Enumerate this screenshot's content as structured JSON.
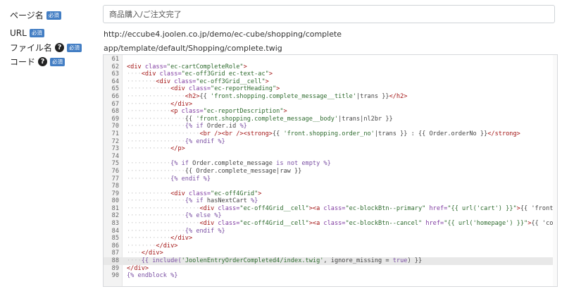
{
  "form": {
    "page_name": {
      "label": "ページ名",
      "badge": "必須",
      "value": "商品購入/ご注文完了"
    },
    "url": {
      "label": "URL",
      "badge": "必須",
      "value": "http://eccube4.joolen.co.jp/demo/ec-cube/shopping/complete"
    },
    "file_name": {
      "label": "ファイル名",
      "badge": "必須",
      "value": "app/template/default/Shopping/complete.twig"
    },
    "code": {
      "label": "コード",
      "badge": "必須"
    }
  },
  "editor": {
    "active_line": 88,
    "lines": [
      {
        "n": "61",
        "indent": 0,
        "tokens": []
      },
      {
        "n": "62",
        "indent": 0,
        "tokens": [
          [
            "tg",
            "<div "
          ],
          [
            "at",
            "class="
          ],
          [
            "st",
            "\"ec-cartCompleteRole\""
          ],
          [
            "tg",
            ">"
          ]
        ]
      },
      {
        "n": "63",
        "indent": 1,
        "tokens": [
          [
            "tg",
            "<div "
          ],
          [
            "at",
            "class="
          ],
          [
            "st",
            "\"ec-off3Grid ec-text-ac\""
          ],
          [
            "tg",
            ">"
          ]
        ]
      },
      {
        "n": "64",
        "indent": 2,
        "tokens": [
          [
            "tg",
            "<div "
          ],
          [
            "at",
            "class="
          ],
          [
            "st",
            "\"ec-off3Grid__cell\""
          ],
          [
            "tg",
            ">"
          ]
        ]
      },
      {
        "n": "65",
        "indent": 3,
        "tokens": [
          [
            "tg",
            "<div "
          ],
          [
            "at",
            "class="
          ],
          [
            "st",
            "\"ec-reportHeading\""
          ],
          [
            "tg",
            ">"
          ]
        ]
      },
      {
        "n": "66",
        "indent": 4,
        "tokens": [
          [
            "tg",
            "<h2>"
          ],
          [
            "tx",
            "{{ "
          ],
          [
            "st",
            "'front.shopping.complete_message__title'"
          ],
          [
            "tx",
            "|trans }}"
          ],
          [
            "tg",
            "</h2>"
          ]
        ]
      },
      {
        "n": "67",
        "indent": 3,
        "tokens": [
          [
            "tg",
            "</div>"
          ]
        ]
      },
      {
        "n": "68",
        "indent": 3,
        "tokens": [
          [
            "tg",
            "<p "
          ],
          [
            "at",
            "class="
          ],
          [
            "st",
            "\"ec-reportDescription\""
          ],
          [
            "tg",
            ">"
          ]
        ]
      },
      {
        "n": "69",
        "indent": 4,
        "tokens": [
          [
            "tx",
            "{{ "
          ],
          [
            "st",
            "'front.shopping.complete_message__body'"
          ],
          [
            "tx",
            "|trans|nl2br }}"
          ]
        ]
      },
      {
        "n": "70",
        "indent": 4,
        "tokens": [
          [
            "kw",
            "{% "
          ],
          [
            "kw",
            "if "
          ],
          [
            "tx",
            "Order.id "
          ],
          [
            "kw",
            "%}"
          ]
        ]
      },
      {
        "n": "71",
        "indent": 5,
        "tokens": [
          [
            "tg",
            "<br /><br /><strong>"
          ],
          [
            "tx",
            "{{ "
          ],
          [
            "st",
            "'front.shopping.order_no'"
          ],
          [
            "tx",
            "|trans }} : {{ Order.orderNo }}"
          ],
          [
            "tg",
            "</strong>"
          ]
        ]
      },
      {
        "n": "72",
        "indent": 4,
        "tokens": [
          [
            "kw",
            "{% "
          ],
          [
            "kw",
            "endif "
          ],
          [
            "kw",
            "%}"
          ]
        ]
      },
      {
        "n": "73",
        "indent": 3,
        "tokens": [
          [
            "tg",
            "</p>"
          ]
        ]
      },
      {
        "n": "74",
        "indent": 0,
        "tokens": []
      },
      {
        "n": "75",
        "indent": 3,
        "tokens": [
          [
            "kw",
            "{% "
          ],
          [
            "kw",
            "if "
          ],
          [
            "tx",
            "Order.complete_message "
          ],
          [
            "kw",
            "is not empty "
          ],
          [
            "kw",
            "%}"
          ]
        ]
      },
      {
        "n": "76",
        "indent": 4,
        "tokens": [
          [
            "tx",
            "{{ Order.complete_message|raw }}"
          ]
        ]
      },
      {
        "n": "77",
        "indent": 3,
        "tokens": [
          [
            "kw",
            "{% "
          ],
          [
            "kw",
            "endif "
          ],
          [
            "kw",
            "%}"
          ]
        ]
      },
      {
        "n": "78",
        "indent": 0,
        "tokens": []
      },
      {
        "n": "79",
        "indent": 3,
        "tokens": [
          [
            "tg",
            "<div "
          ],
          [
            "at",
            "class="
          ],
          [
            "st",
            "\"ec-off4Grid\""
          ],
          [
            "tg",
            ">"
          ]
        ]
      },
      {
        "n": "80",
        "indent": 4,
        "tokens": [
          [
            "kw",
            "{% "
          ],
          [
            "kw",
            "if "
          ],
          [
            "tx",
            "hasNextCart "
          ],
          [
            "kw",
            "%}"
          ]
        ]
      },
      {
        "n": "81",
        "indent": 5,
        "tokens": [
          [
            "tg",
            "<div "
          ],
          [
            "at",
            "class="
          ],
          [
            "st",
            "\"ec-off4Grid__cell\""
          ],
          [
            "tg",
            "><a "
          ],
          [
            "at",
            "class="
          ],
          [
            "st",
            "\"ec-blockBtn--primary\""
          ],
          [
            "tg",
            " "
          ],
          [
            "at",
            "href="
          ],
          [
            "st",
            "\"{{ url('cart') }}\""
          ],
          [
            "tg",
            ">"
          ],
          [
            "tx",
            "{{ 'front.shopping"
          ]
        ]
      },
      {
        "n": "82",
        "indent": 4,
        "tokens": [
          [
            "kw",
            "{% "
          ],
          [
            "kw",
            "else "
          ],
          [
            "kw",
            "%}"
          ]
        ]
      },
      {
        "n": "83",
        "indent": 5,
        "tokens": [
          [
            "tg",
            "<div "
          ],
          [
            "at",
            "class="
          ],
          [
            "st",
            "\"ec-off4Grid__cell\""
          ],
          [
            "tg",
            "><a "
          ],
          [
            "at",
            "class="
          ],
          [
            "st",
            "\"ec-blockBtn--cancel\""
          ],
          [
            "tg",
            " "
          ],
          [
            "at",
            "href="
          ],
          [
            "st",
            "\"{{ url('homepage') }}\""
          ],
          [
            "tg",
            ">"
          ],
          [
            "tx",
            "{{ 'common.go_t"
          ]
        ]
      },
      {
        "n": "84",
        "indent": 4,
        "tokens": [
          [
            "kw",
            "{% "
          ],
          [
            "kw",
            "endif "
          ],
          [
            "kw",
            "%}"
          ]
        ]
      },
      {
        "n": "85",
        "indent": 3,
        "tokens": [
          [
            "tg",
            "</div>"
          ]
        ]
      },
      {
        "n": "86",
        "indent": 2,
        "tokens": [
          [
            "tg",
            "</div>"
          ]
        ]
      },
      {
        "n": "87",
        "indent": 1,
        "tokens": [
          [
            "tg",
            "</div>"
          ]
        ]
      },
      {
        "n": "88",
        "indent": 1,
        "tokens": [
          [
            "kw",
            "{{ "
          ],
          [
            "kw",
            "include("
          ],
          [
            "st",
            "'JoolenEntryOrderCompleted4/index.twig'"
          ],
          [
            "tx",
            ", ignore_missing = "
          ],
          [
            "kw",
            "true"
          ],
          [
            "tx",
            ") }}"
          ]
        ]
      },
      {
        "n": "89",
        "indent": 0,
        "tokens": [
          [
            "tg",
            "</div>"
          ]
        ]
      },
      {
        "n": "90",
        "indent": 0,
        "tokens": [
          [
            "kw",
            "{% "
          ],
          [
            "kw",
            "endblock "
          ],
          [
            "kw",
            "%}"
          ]
        ]
      }
    ]
  }
}
